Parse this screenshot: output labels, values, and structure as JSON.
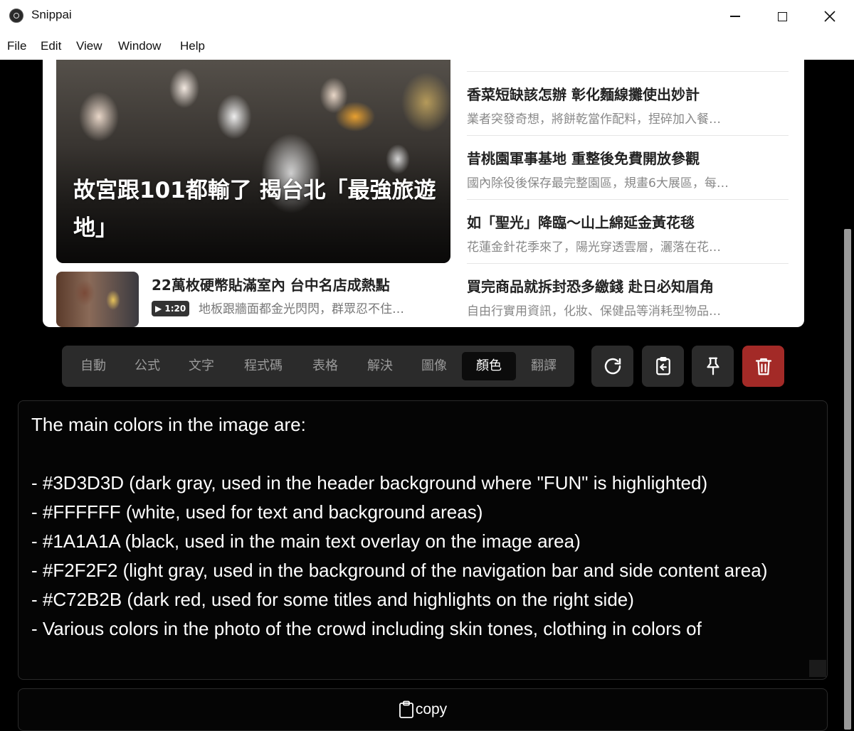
{
  "window": {
    "title": "Snippai",
    "icon": "app-logo-icon"
  },
  "menu": [
    "File",
    "Edit",
    "View",
    "Window",
    "Help"
  ],
  "snip": {
    "hero_title": "故宮跟101都輸了 揭台北「最強旅遊地」",
    "video": {
      "title": "22萬枚硬幣貼滿室內 台中名店成熱點",
      "duration": "▶ 1:20",
      "description": "地板跟牆面都金光閃閃，群眾忍不住…"
    },
    "side_items": [
      {
        "title": "香菜短缺該怎辦 彰化麵線攤使出妙計",
        "desc": "業者突發奇想，將餅乾當作配料，捏碎加入餐…"
      },
      {
        "title": "昔桃園軍事基地 重整後免費開放參觀",
        "desc": "國內除役後保存最完整園區，規畫6大展區，每…"
      },
      {
        "title": "如「聖光」降臨～山上綿延金黃花毯",
        "desc": "花蓮金針花季來了，陽光穿透雲層，灑落在花…"
      },
      {
        "title": "買完商品就拆封恐多繳錢 赴日必知眉角",
        "desc": "自由行實用資訊，化妝、保健品等消耗型物品…"
      }
    ]
  },
  "tabs": [
    {
      "label": "自動"
    },
    {
      "label": "公式"
    },
    {
      "label": "文字"
    },
    {
      "label": "程式碼"
    },
    {
      "label": "表格"
    },
    {
      "label": "解決"
    },
    {
      "label": "圖像"
    },
    {
      "label": "顏色",
      "active": true
    },
    {
      "label": "翻譯"
    }
  ],
  "tools": [
    "refresh-icon",
    "clipboard-export-icon",
    "pin-icon",
    "trash-icon"
  ],
  "result": {
    "text": "The main colors in the image are:\n\n- #3D3D3D (dark gray, used in the header background where \"FUN\" is highlighted)\n- #FFFFFF (white, used for text and background areas)\n- #1A1A1A (black, used in the main text overlay on the image area)\n- #F2F2F2 (light gray, used in the background of the navigation bar and side content area)\n- #C72B2B (dark red, used for some titles and highlights on the right side)\n- Various colors in the photo of the crowd including skin tones, clothing in colors of"
  },
  "copy_label": "copy",
  "colors": {
    "danger": "#a32a27",
    "panel": "#2b2b2b"
  }
}
